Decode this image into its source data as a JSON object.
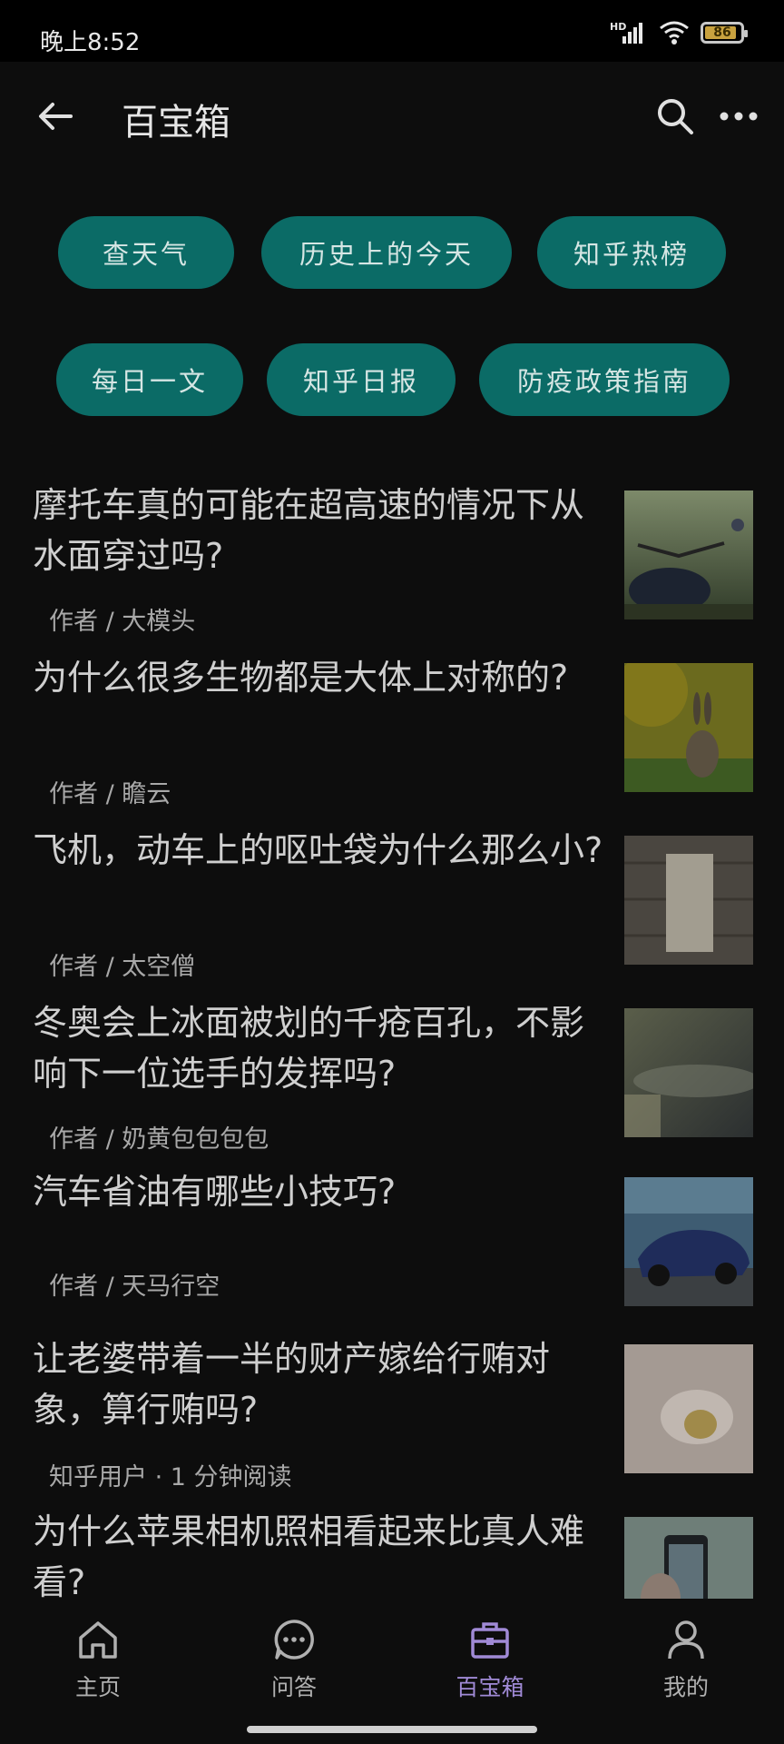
{
  "status": {
    "time": "晚上8:52",
    "network": "HD",
    "battery": "86"
  },
  "header": {
    "title": "百宝箱"
  },
  "chips_row1": [
    "查天气",
    "历史上的今天",
    "知乎热榜"
  ],
  "chips_row2": [
    "每日一文",
    "知乎日报",
    "防疫政策指南"
  ],
  "articles": [
    {
      "title": "摩托车真的可能在超高速的情况下从水面穿过吗?",
      "meta": "作者 / 大模头"
    },
    {
      "title": "为什么很多生物都是大体上对称的?",
      "meta": "作者 / 瞻云"
    },
    {
      "title": "飞机，动车上的呕吐袋为什么那么小?",
      "meta": "作者 / 太空僧"
    },
    {
      "title": "冬奥会上冰面被划的千疮百孔，不影响下一位选手的发挥吗?",
      "meta": "作者 / 奶黄包包包包"
    },
    {
      "title": "汽车省油有哪些小技巧?",
      "meta": "作者 / 天马行空"
    },
    {
      "title": "让老婆带着一半的财产嫁给行贿对象，算行贿吗?",
      "meta": "知乎用户 · 1 分钟阅读"
    },
    {
      "title": "为什么苹果相机照相看起来比真人难看?",
      "meta": ""
    }
  ],
  "nav": [
    {
      "label": "主页",
      "icon": "home-icon"
    },
    {
      "label": "问答",
      "icon": "chat-icon"
    },
    {
      "label": "百宝箱",
      "icon": "toolbox-icon",
      "active": true
    },
    {
      "label": "我的",
      "icon": "person-icon"
    }
  ],
  "colors": {
    "chip": "#0b6b66",
    "accent": "#a08ad6",
    "background": "#0d0d0d"
  }
}
